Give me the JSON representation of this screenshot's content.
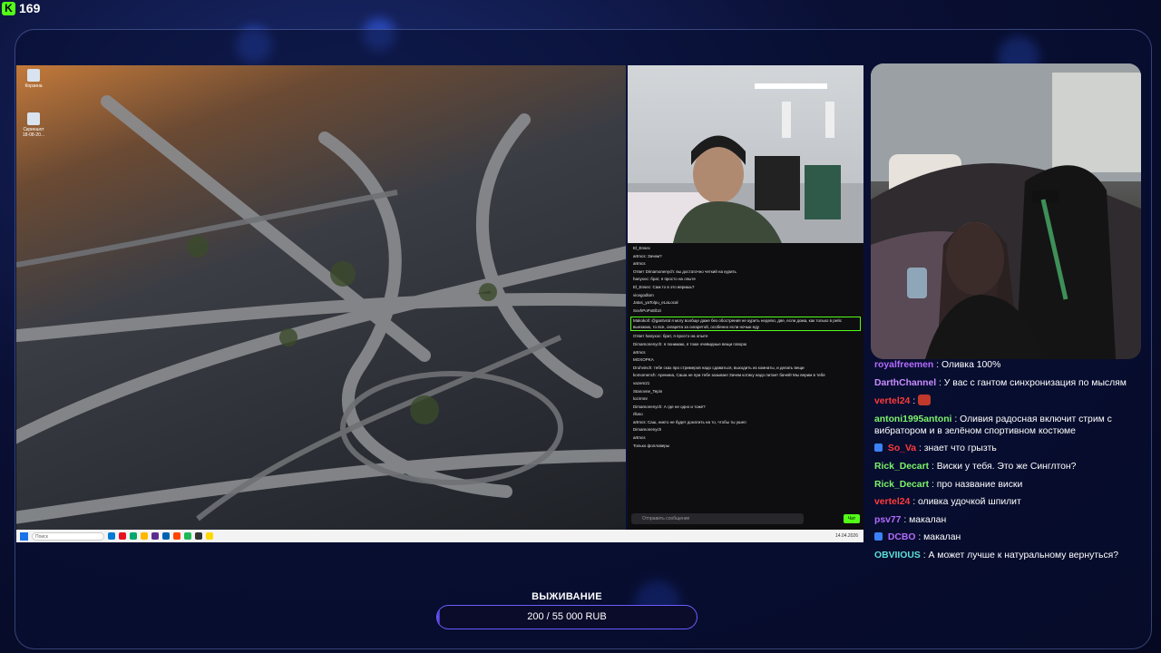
{
  "stream": {
    "viewer_count": "169"
  },
  "desktop": {
    "icons": [
      {
        "label": "Корзина",
        "icon": "recycle-bin-icon"
      },
      {
        "label": "Скриншот 18-08-20...",
        "icon": "screenshot-file-icon"
      }
    ],
    "taskbar": {
      "search_placeholder": "Поиск",
      "apps": [
        "#0078d4",
        "#e81123",
        "#00a86b",
        "#ffb900",
        "#5c2d91",
        "#0063b1",
        "#ff4500",
        "#1db954",
        "#333333",
        "#ffd800"
      ],
      "clock": "14.04.2026"
    }
  },
  "embedded_chat": {
    "lines": [
      "El_Ensec",
      "artmcs: Зачем?",
      "artmcs",
      "Ответ Dimamonenych: вы достаточно четкий на курить",
      "hanyxoc: брат, я просто на опыте",
      "El_Ensec: Сам то в это веришь?",
      "vicegodlom",
      "Jatus_yaTolpu_eLaLocal",
      "SovhPoPoElbzi",
      "Makokoll: @gantvrat я могу вообще даже без обострения не курить неделю, две, если дома, как только в рейс выезжаю, то все, сигарета за сигаретой, особенно если ночью еду",
      "Ответ hanyxoc: брат, я просто на опыте",
      "Dimamonenych: я понимаю, я тоже очевидные вещи говорю",
      "artmcs",
      "MOXOPKA",
      "Druhvinch: тебе сказ про стримеров надо сдаваться, выходить из комнаты, и делать вещи",
      "komomench: Аренина, Саша не при тебе зазыван! Зачем котику надо питает бачей! Мы верим в тебя",
      "vazem21",
      "Stanovne_Tepin",
      "lozirmnr",
      "Dimamonenych: А где не одно и тоже?",
      "rlluso",
      "artmcs: Саш, никто не будет донатить на то, чтобы ты ушел",
      "Dimamonenych",
      "artmcs",
      "Только фолловеры"
    ],
    "input_placeholder": "Отправить сообщение",
    "send_label": "Чат"
  },
  "chat": {
    "messages": [
      {
        "user": "royalfreemen",
        "color": "#b36bff",
        "text": "Оливка 100%",
        "badge": false,
        "emote": false
      },
      {
        "user": "DarthChannel",
        "color": "#c98bff",
        "text": "У вас с гантом синхронизация по мыслям",
        "badge": false,
        "emote": false
      },
      {
        "user": "vertel24",
        "color": "#ff3b3b",
        "text": "",
        "badge": false,
        "emote": true
      },
      {
        "user": "antoni1995antoni",
        "color": "#7cf26a",
        "text": "Оливия радосная включит стрим с вибратором и в зелёном спортивном костюме",
        "badge": false,
        "emote": false
      },
      {
        "user": "So_Va",
        "color": "#ff3b3b",
        "text": "знает что грызть",
        "badge": true,
        "emote": false
      },
      {
        "user": "Rick_Decart",
        "color": "#7cf26a",
        "text": "Виски у тебя. Это же Синглтон?",
        "badge": false,
        "emote": false
      },
      {
        "user": "Rick_Decart",
        "color": "#7cf26a",
        "text": "про название виски",
        "badge": false,
        "emote": false
      },
      {
        "user": "vertel24",
        "color": "#ff3b3b",
        "text": "оливка удочкой шпилит",
        "badge": false,
        "emote": false
      },
      {
        "user": "psv77",
        "color": "#b36bff",
        "text": "макалан",
        "badge": false,
        "emote": false
      },
      {
        "user": "DCBO",
        "color": "#b36bff",
        "text": "макалан",
        "badge": true,
        "emote": false
      },
      {
        "user": "OBVIIOUS",
        "color": "#5ce0d8",
        "text": "А может лучше к натуральному вернуться?",
        "badge": false,
        "emote": false
      }
    ]
  },
  "goal": {
    "title": "ВЫЖИВАНИЕ",
    "progress_text": "200 / 55 000 RUB",
    "progress_fraction": 0.0036
  },
  "colors": {
    "accent_green": "#53fc18",
    "goal_border": "#6d5cff"
  }
}
